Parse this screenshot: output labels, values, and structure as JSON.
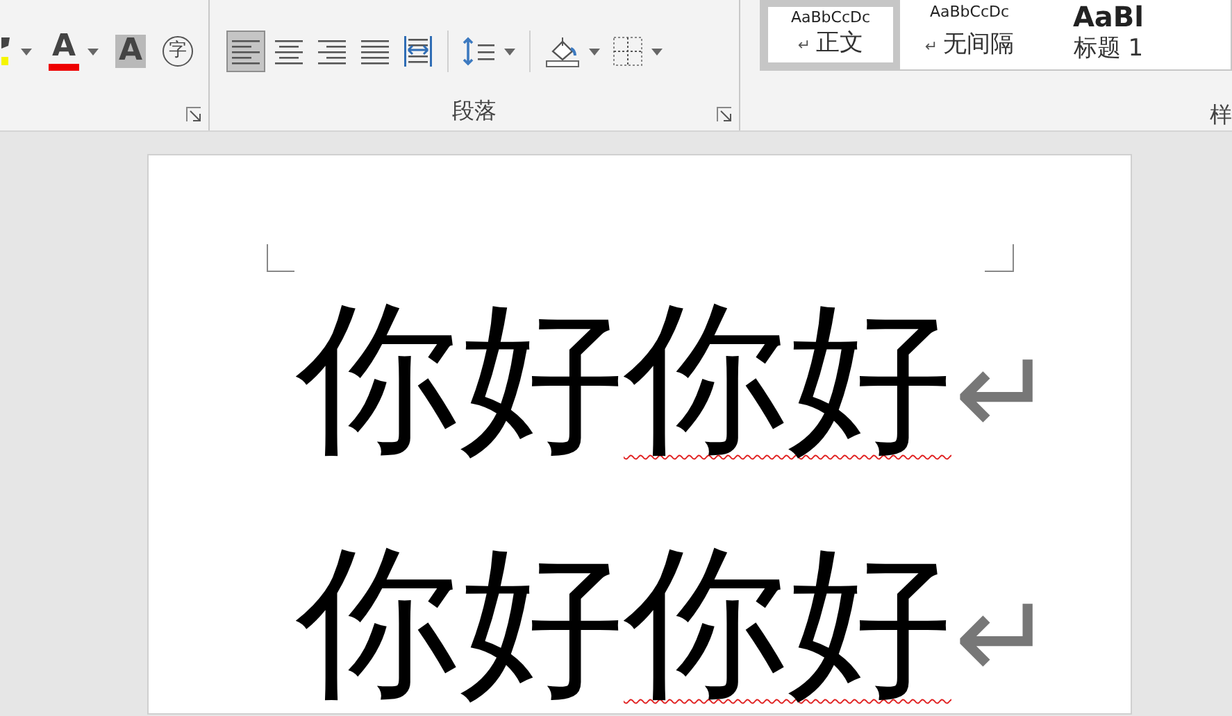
{
  "ribbon": {
    "font_tools": [
      {
        "kind": "highlight",
        "caret": true
      },
      {
        "kind": "font-color",
        "glyph": "A",
        "caret": true
      },
      {
        "kind": "char-shading",
        "glyph": "A",
        "caret": false
      },
      {
        "kind": "enclosed",
        "glyph": "字",
        "caret": false
      }
    ],
    "paragraph_tools": [
      {
        "kind": "align-left",
        "selected": true,
        "caret": false
      },
      {
        "kind": "align-center",
        "selected": false,
        "caret": false
      },
      {
        "kind": "align-right",
        "selected": false,
        "caret": false
      },
      {
        "kind": "justify",
        "selected": false,
        "caret": false
      },
      {
        "kind": "distribute",
        "selected": false,
        "caret": false
      },
      {
        "kind": "line-spacing",
        "caret": true
      },
      {
        "kind": "shading",
        "caret": true
      },
      {
        "kind": "borders",
        "caret": true
      }
    ],
    "paragraph_label": "段落",
    "styles": [
      {
        "preview": "AaBbCcDc",
        "mark": "↵",
        "name": "正文",
        "selected": true
      },
      {
        "preview": "AaBbCcDc",
        "mark": "↵",
        "name": "无间隔",
        "selected": false
      },
      {
        "preview": "AaBl",
        "name": "标题 1",
        "selected": false
      }
    ],
    "styles_label": "样"
  },
  "document": {
    "paragraphs": [
      {
        "runs": [
          {
            "text": "你好",
            "flagged": false
          },
          {
            "text": "你好",
            "flagged": true
          }
        ],
        "end_mark": "↵"
      },
      {
        "runs": [
          {
            "text": "你好",
            "flagged": false
          },
          {
            "text": "你好",
            "flagged": true
          }
        ],
        "end_mark": "↵"
      }
    ]
  }
}
